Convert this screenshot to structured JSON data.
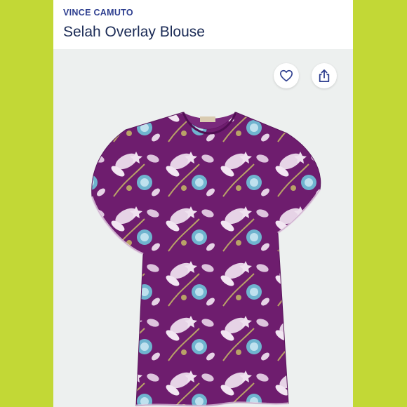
{
  "listing": {
    "brand": "VINCE CAMUTO",
    "title": "Selah Overlay Blouse"
  },
  "icons": {
    "like": "heart-icon",
    "share": "share-icon"
  },
  "colors": {
    "frame": "#c2d836",
    "card_background": "#edf0ef",
    "brand_text": "#2d3e8f",
    "title_text": "#1a2a55",
    "blouse_base": "#6e1d6e",
    "print_light": "#e6d3e6",
    "print_teal": "#6fb4cf",
    "print_gold": "#b9a267"
  }
}
